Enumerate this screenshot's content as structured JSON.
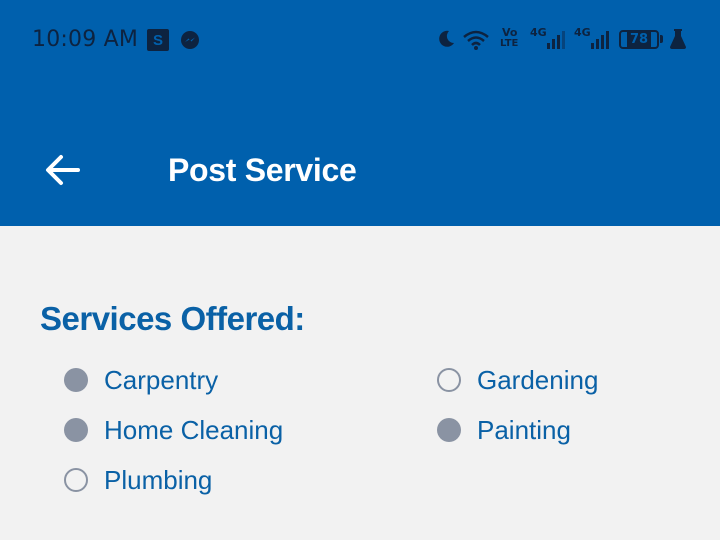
{
  "status_bar": {
    "time": "10:09 AM",
    "notification_s": "S",
    "volte_top": "Vo",
    "volte_bottom": "LTE",
    "network1": "4G",
    "network2": "4G",
    "battery": "78"
  },
  "header": {
    "title": "Post Service",
    "background_color": "#0060ad"
  },
  "services": {
    "title": "Services Offered:",
    "options": [
      {
        "label": "Carpentry",
        "checked": true
      },
      {
        "label": "Gardening",
        "checked": false
      },
      {
        "label": "Home Cleaning",
        "checked": true
      },
      {
        "label": "Painting",
        "checked": true
      },
      {
        "label": "Plumbing",
        "checked": false
      }
    ]
  },
  "colors": {
    "accent": "#0a61a6",
    "radio": "#8a93a3"
  }
}
